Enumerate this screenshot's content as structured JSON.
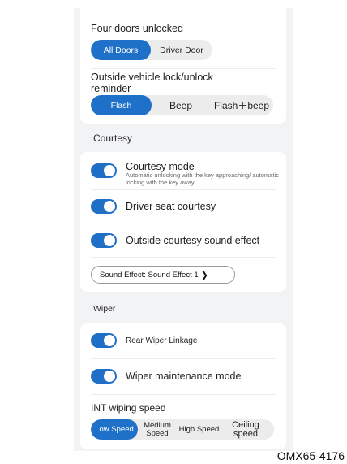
{
  "lock_card": {
    "doors_title": "Four doors unlocked",
    "doors_options": [
      "All Doors",
      "Driver Door"
    ],
    "reminder_title": "Outside vehicle lock/unlock reminder",
    "reminder_options": [
      "Flash",
      "Beep",
      "Flash＋beep"
    ]
  },
  "courtesy": {
    "section_label": "Courtesy",
    "courtesy_mode_label": "Courtesy mode",
    "courtesy_mode_desc": "Automatic unlocking with the key approaching/ automatic locking with the key away",
    "driver_seat_label": "Driver seat courtesy",
    "sound_effect_label": "Outside courtesy sound effect",
    "sound_effect_button": "Sound Effect: Sound Effect 1",
    "chevron": "❯"
  },
  "wiper": {
    "section_label": "Wiper",
    "rear_linkage_label": "Rear Wiper Linkage",
    "maintenance_label": "Wiper maintenance mode",
    "int_speed_title": "INT wiping speed",
    "int_speed_options": [
      "Low Speed",
      "Medium Speed",
      "High Speed",
      "Ceiling speed"
    ]
  },
  "footer_code": "OMX65-4176",
  "colors": {
    "accent": "#1e70c8",
    "panel_bg": "#f2f3f5",
    "card_bg": "#ffffff"
  },
  "state": {
    "doors_selected": "All Doors",
    "reminder_selected": "Flash",
    "int_speed_selected": "Low Speed",
    "courtesy_mode_on": true,
    "driver_seat_courtesy_on": true,
    "outside_sound_effect_on": true,
    "rear_wiper_linkage_on": true,
    "wiper_maintenance_on": true
  }
}
